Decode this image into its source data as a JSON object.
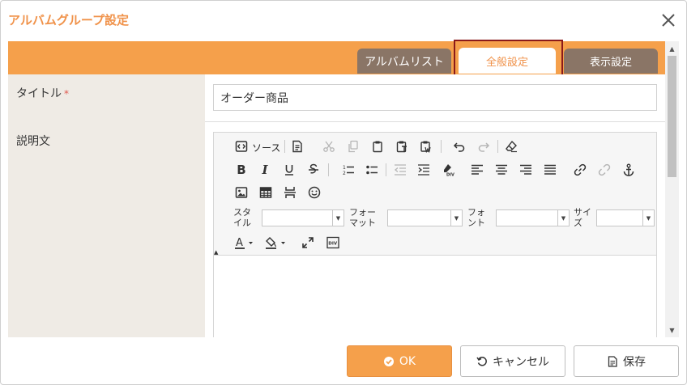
{
  "dialog": {
    "title": "アルバムグループ設定"
  },
  "tabs": [
    {
      "label": "アルバムリスト"
    },
    {
      "label": "全般設定"
    },
    {
      "label": "表示設定"
    }
  ],
  "form": {
    "title_label": "タイトル",
    "required_mark": "*",
    "title_value": "オーダー商品",
    "description_label": "説明文"
  },
  "editor": {
    "source_label": "ソース",
    "style_label": "スタイル",
    "format_label": "フォーマット",
    "font_label": "フォント",
    "size_label": "サイズ",
    "style_value": "",
    "format_value": "",
    "font_value": "",
    "size_value": ""
  },
  "footer": {
    "ok_label": "OK",
    "cancel_label": "キャンセル",
    "save_label": "保存"
  },
  "colors": {
    "accent": "#f5a04b",
    "tab_inactive": "#8a7566",
    "highlight": "#8b1a1a"
  }
}
